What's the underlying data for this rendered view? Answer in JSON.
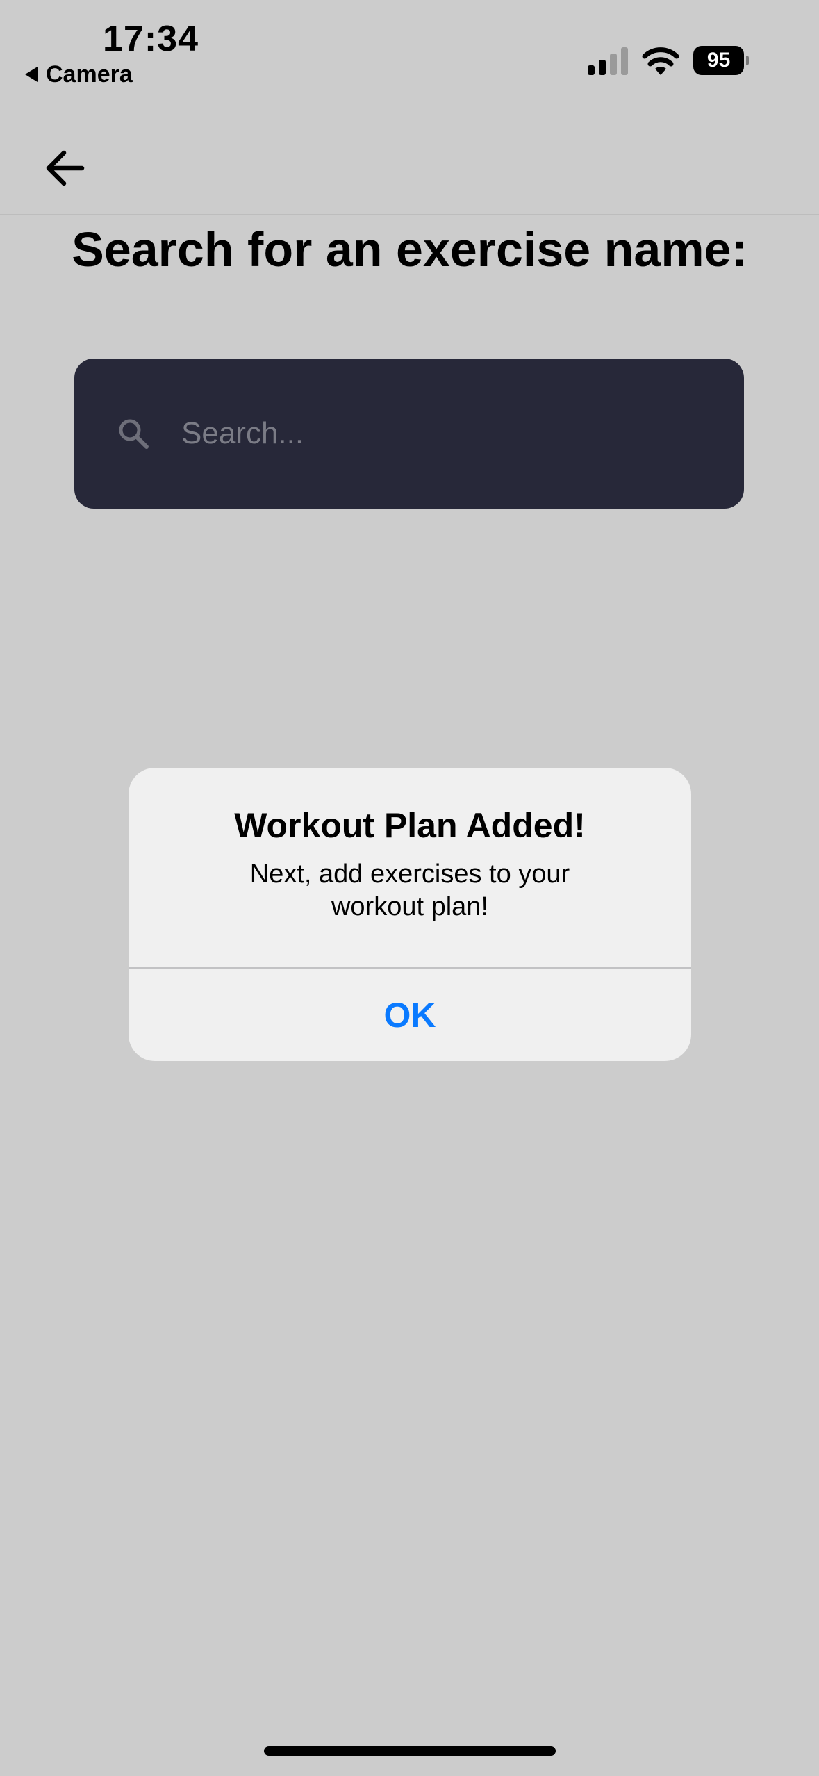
{
  "status_bar": {
    "time": "17:34",
    "back_app_label": "Camera",
    "battery_level": "95",
    "signal_bars_active": 2,
    "signal_bars_total": 4
  },
  "nav": {
    "back_icon": "arrow-left-icon"
  },
  "page": {
    "title": "Search for an exercise name:"
  },
  "search": {
    "icon": "search-icon",
    "placeholder": "Search...",
    "value": ""
  },
  "alert": {
    "title": "Workout Plan Added!",
    "message": "Next, add exercises to your workout plan!",
    "ok_label": "OK"
  },
  "colors": {
    "background": "#cccccc",
    "search_background": "#272839",
    "alert_background": "#f0f0f0",
    "accent_blue": "#0a7aff"
  }
}
